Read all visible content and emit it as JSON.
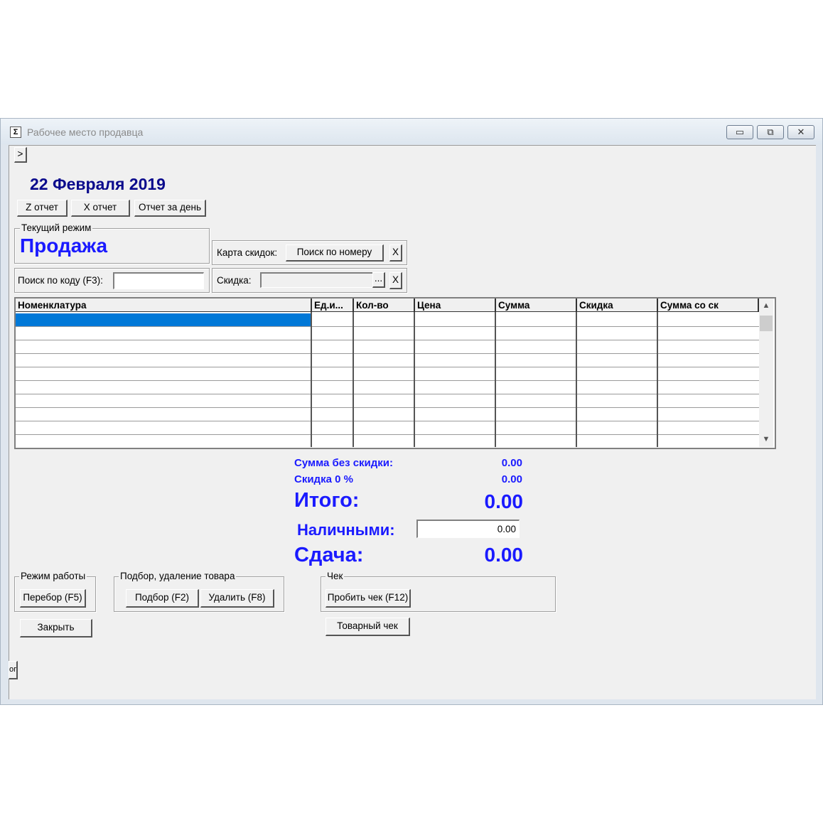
{
  "window": {
    "title": "Рабочее место продавца",
    "buttons": {
      "minimize": "▭",
      "maximize": "⧉",
      "close": "✕"
    }
  },
  "toolbar": {
    "expand": ">"
  },
  "date": "22 Февраля 2019",
  "reports": {
    "z": "Z отчет",
    "x": "X отчет",
    "day": "Отчет за день"
  },
  "mode": {
    "label": "Текущий режим",
    "value": "Продажа"
  },
  "discount_card": {
    "label": "Карта скидок:",
    "search_button": "Поиск по номеру",
    "clear": "X"
  },
  "code_search": {
    "label": "Поиск по коду (F3):",
    "value": ""
  },
  "discount": {
    "label": "Скидка:",
    "value": "",
    "browse": "...",
    "clear": "X"
  },
  "table": {
    "columns": [
      "Номенклатура",
      "Ед.и...",
      "Кол-во",
      "Цена",
      "Сумма",
      "Скидка",
      "Сумма со ск"
    ],
    "rows": 10
  },
  "totals": {
    "sum_no_discount_label": "Сумма без скидки:",
    "sum_no_discount_value": "0.00",
    "discount_label": "Скидка 0 %",
    "discount_value": "0.00",
    "total_label": "Итого:",
    "total_value": "0.00",
    "cash_label": "Наличными:",
    "cash_value": "0.00",
    "change_label": "Сдача:",
    "change_value": "0.00"
  },
  "work_mode": {
    "label": "Режим работы",
    "button": "Перебор (F5)"
  },
  "goods": {
    "label": "Подбор, удаление товара",
    "select_button": "Подбор (F2)",
    "delete_button": "Удалить (F8)"
  },
  "receipt": {
    "label": "Чек",
    "print_button": "Пробить чек (F12)",
    "goods_receipt_button": "Товарный чек"
  },
  "close_button": "Закрыть",
  "side_stub": "ог",
  "colors": {
    "accent_blue": "#1a1aff",
    "date_blue": "#0a0a8c",
    "selection": "#0078d7"
  }
}
